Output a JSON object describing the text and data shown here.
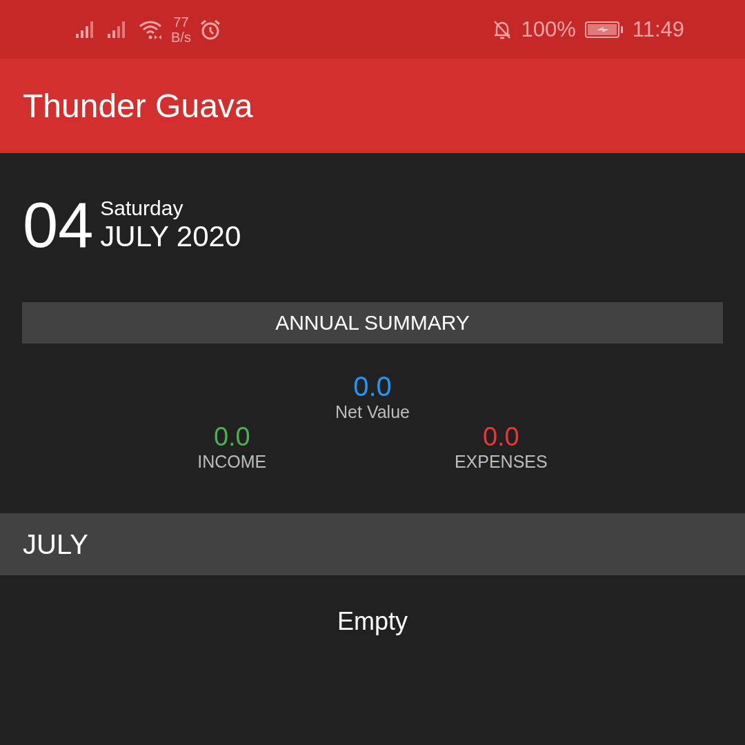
{
  "status_bar": {
    "net_speed": "77",
    "net_unit": "B/s",
    "battery": "100%",
    "time": "11:49"
  },
  "app_bar": {
    "title": "Thunder Guava"
  },
  "date": {
    "day": "04",
    "weekday": "Saturday",
    "month_year": "JULY 2020"
  },
  "summary": {
    "heading": "ANNUAL SUMMARY",
    "net": {
      "value": "0.0",
      "label": "Net Value"
    },
    "items": [
      {
        "kind": "income",
        "value": "0.0",
        "label": "INCOME"
      },
      {
        "kind": "expenses",
        "value": "0.0",
        "label": "EXPENSES"
      }
    ]
  },
  "month": {
    "title": "JULY",
    "empty": "Empty"
  }
}
